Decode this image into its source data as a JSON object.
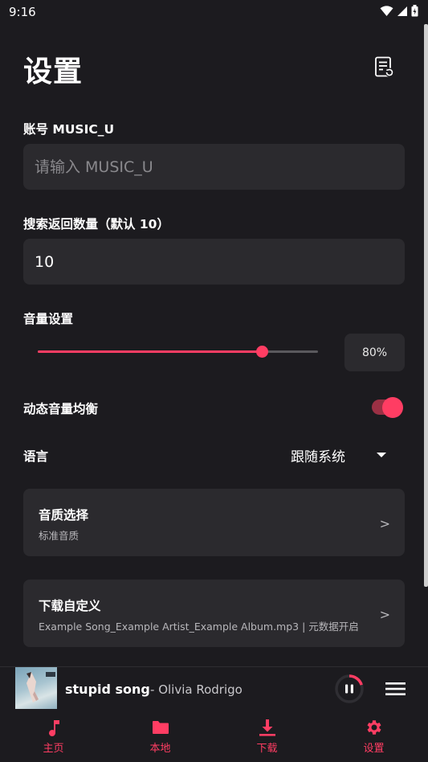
{
  "status": {
    "time": "9:16"
  },
  "header": {
    "title": "设置",
    "log_icon": "document-refresh-icon"
  },
  "account": {
    "label": "账号 MUSIC_U",
    "placeholder": "请输入 MUSIC_U",
    "value": ""
  },
  "search_count": {
    "label": "搜索返回数量（默认 10）",
    "value": "10"
  },
  "volume": {
    "label": "音量设置",
    "value_percent": 80,
    "display": "80%"
  },
  "loudness": {
    "label": "动态音量均衡",
    "enabled": true
  },
  "language": {
    "label": "语言",
    "selected": "跟随系统"
  },
  "quality_card": {
    "title": "音质选择",
    "subtitle": "标准音质",
    "arrow": ">"
  },
  "download_card": {
    "title": "下载自定义",
    "subtitle": "Example Song_Example Artist_Example Album.mp3 | 元数据开启",
    "arrow": ">"
  },
  "player": {
    "song": "stupid song",
    "separator": " - ",
    "artist": "Olivia Rodrigo",
    "state": "playing",
    "progress": 0.2
  },
  "nav": {
    "items": [
      {
        "label": "主页",
        "icon": "music-note-icon"
      },
      {
        "label": "本地",
        "icon": "folder-icon"
      },
      {
        "label": "下载",
        "icon": "download-icon"
      },
      {
        "label": "设置",
        "icon": "gear-icon"
      }
    ]
  },
  "colors": {
    "accent": "#ff3d63",
    "background": "#1c1b1f",
    "surface": "#2b2a2e"
  }
}
